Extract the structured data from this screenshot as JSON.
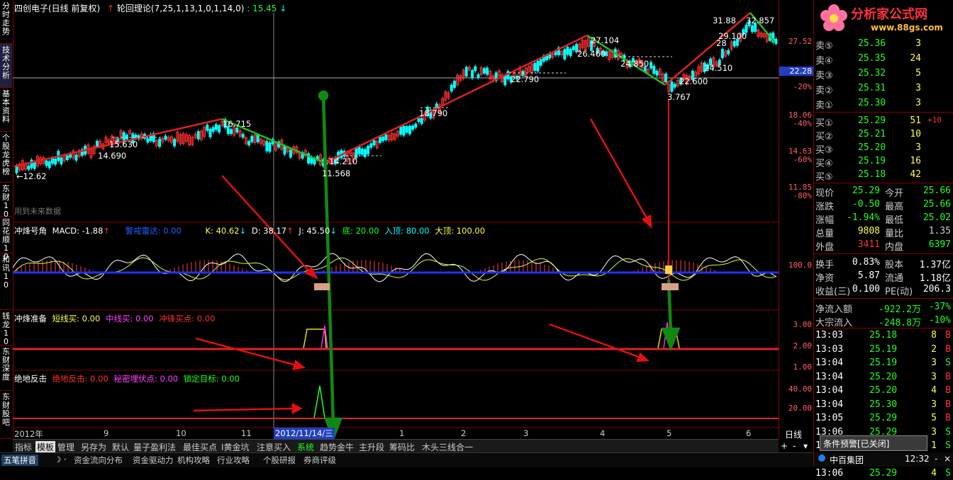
{
  "left_tabs": [
    "分时走势",
    "技术分析",
    "基本资料",
    "个股龙虎榜",
    "东财10",
    "同花顺10",
    "和讯10",
    "钱龙10",
    "东财深度",
    "东财股吧"
  ],
  "header": {
    "stock": "四创电子(日线 前复权)",
    "indicator": "轮回理论(7,25,1,13,1,0,1,14,0)",
    "value": ": 15.45"
  },
  "main_labels": {
    "p_3188": "31.88",
    "p_32857": "32.857",
    "p_29100": "29.100",
    "p_28": "28",
    "p_26460": "26.460",
    "p_27104": "27.104",
    "p_24850": "24.850",
    "p_24510": "24.510",
    "p_22600": "22.600",
    "p_22790": "22.790",
    "p_18790": "18.790",
    "p_16715": "16.715",
    "p_15630": "15.630",
    "p_14690": "14.690",
    "p_14210": "14.210",
    "p_11568": "11.568",
    "p_12": "←12.62",
    "p_3767": "3.767",
    "future_note": "用到未来数据"
  },
  "macd_bar": {
    "name": "冲烽号角",
    "macd": "MACD: -1.88",
    "alert": "警戒雷达: 0.00",
    "k": "K: 40.62",
    "d": "D: 38.17",
    "j": "J: 45.50",
    "bottom": "底: 20.00",
    "entry": "入顶: 80.00",
    "top": "大顶: 100.00"
  },
  "prep_bar": {
    "name": "冲烽准备",
    "short": "短线买: 0.00",
    "mid": "中线买: 0.00",
    "buy": "冲锋买点: 0.00"
  },
  "counter_bar": {
    "name": "绝地反击",
    "counter": "绝地反击: 0.00",
    "secret": "秘密埋伏点: 0.00",
    "target": "锁定目标: 0.00"
  },
  "axis_main": [
    {
      "label": "27.52",
      "pct": ""
    },
    {
      "label": "22.28",
      "pct": ""
    },
    {
      "label": "-20%",
      "pct": ""
    },
    {
      "label": "18.06",
      "pct": ""
    },
    {
      "label": "-40%",
      "pct": ""
    },
    {
      "label": "14.63",
      "pct": ""
    },
    {
      "label": "-60%",
      "pct": ""
    },
    {
      "label": "11.85",
      "pct": ""
    },
    {
      "label": "-80%",
      "pct": ""
    }
  ],
  "axis_macd": [
    "100.0"
  ],
  "axis_prep": [
    "3.00",
    "2.00",
    "1.00"
  ],
  "axis_counter": [
    "40.00",
    "20.00"
  ],
  "time_axis": [
    "2012年",
    "9",
    "10",
    "11",
    "2012/11/14/三",
    "1",
    "2",
    "3",
    "4",
    "5",
    "6"
  ],
  "axis_mode": "日线",
  "bottom_tabs": [
    "指标",
    "模板",
    "管理",
    "另存为",
    "默认",
    "量子盈利法",
    "最佳买点",
    "I黄金坑",
    "注意买入",
    "系统",
    "趋势金牛",
    "主升段",
    "筹码比",
    "木头三线合一"
  ],
  "status_tabs": [
    "五笔拼音",
    "资金流向分布",
    "资金驱动力",
    "机构攻略",
    "行业攻略",
    "个股研报",
    "券商评级"
  ],
  "logo": {
    "title": "分析家公式网",
    "url": "www.88gs.com"
  },
  "order_book": {
    "asks": [
      {
        "label": "卖⑤",
        "price": "25.36",
        "vol": "3"
      },
      {
        "label": "卖④",
        "price": "25.35",
        "vol": "24"
      },
      {
        "label": "卖③",
        "price": "25.32",
        "vol": "5"
      },
      {
        "label": "卖②",
        "price": "25.31",
        "vol": "3"
      },
      {
        "label": "卖①",
        "price": "25.30",
        "vol": "3"
      }
    ],
    "bids": [
      {
        "label": "买①",
        "price": "25.29",
        "vol": "51",
        "extra": "+10"
      },
      {
        "label": "买②",
        "price": "25.21",
        "vol": "10",
        "extra": ""
      },
      {
        "label": "买③",
        "price": "25.20",
        "vol": "3",
        "extra": ""
      },
      {
        "label": "买④",
        "price": "25.19",
        "vol": "16",
        "extra": ""
      },
      {
        "label": "买⑤",
        "price": "25.18",
        "vol": "42",
        "extra": ""
      }
    ]
  },
  "quote": [
    {
      "l1": "现价",
      "v1": "25.29",
      "l2": "今开",
      "v2": "25.66"
    },
    {
      "l1": "涨跌",
      "v1": "-0.50",
      "l2": "最高",
      "v2": "25.66"
    },
    {
      "l1": "涨幅",
      "v1": "-1.94%",
      "l2": "最低",
      "v2": "25.02"
    },
    {
      "l1": "总量",
      "v1": "9808",
      "l2": "量比",
      "v2": "1.35"
    },
    {
      "l1": "外盘",
      "v1": "3411",
      "l2": "内盘",
      "v2": "6397"
    }
  ],
  "fundamentals": [
    {
      "l1": "换手",
      "v1": "0.83%",
      "l2": "股本",
      "v2": "1.37亿"
    },
    {
      "l1": "净资",
      "v1": "5.87",
      "l2": "流通",
      "v2": "1.18亿"
    },
    {
      "l1": "收益(三)",
      "v1": "0.100",
      "l2": "PE(动)",
      "v2": "206.3"
    }
  ],
  "flows": [
    {
      "label": "净流入额",
      "value": "-922.2万",
      "pct": "-37%"
    },
    {
      "label": "大宗流入",
      "value": "-248.8万",
      "pct": "-10%"
    }
  ],
  "ticks": [
    {
      "time": "13:03",
      "price": "25.18",
      "vol": "8",
      "side": "B"
    },
    {
      "time": "13:03",
      "price": "25.19",
      "vol": "2",
      "side": "B"
    },
    {
      "time": "13:04",
      "price": "25.19",
      "vol": "3",
      "side": "S"
    },
    {
      "time": "13:04",
      "price": "25.20",
      "vol": "3",
      "side": "B"
    },
    {
      "time": "13:04",
      "price": "25.20",
      "vol": "4",
      "side": "B"
    },
    {
      "time": "13:04",
      "price": "25.30",
      "vol": "3",
      "side": "B"
    },
    {
      "time": "13:05",
      "price": "25.29",
      "vol": "5",
      "side": "B"
    },
    {
      "time": "13:06",
      "price": "25.29",
      "vol": "3",
      "side": "S"
    },
    {
      "time": "13:06",
      "price": "25.29",
      "vol": "1",
      "side": "S"
    },
    {
      "time": "13:06",
      "price": "25.29",
      "vol": "10",
      "side": "S"
    },
    {
      "time": "13:06",
      "price": "25.29",
      "vol": "4",
      "side": "S"
    }
  ],
  "alert_popup": "条件预警[已关闭]",
  "status_stock": "中百集团",
  "clock": "12:32",
  "colors": {
    "up": "#ff3232",
    "down": "#00ffff",
    "green": "#00ff00",
    "yellow": "#ffff00",
    "panel_border": "#800000"
  }
}
